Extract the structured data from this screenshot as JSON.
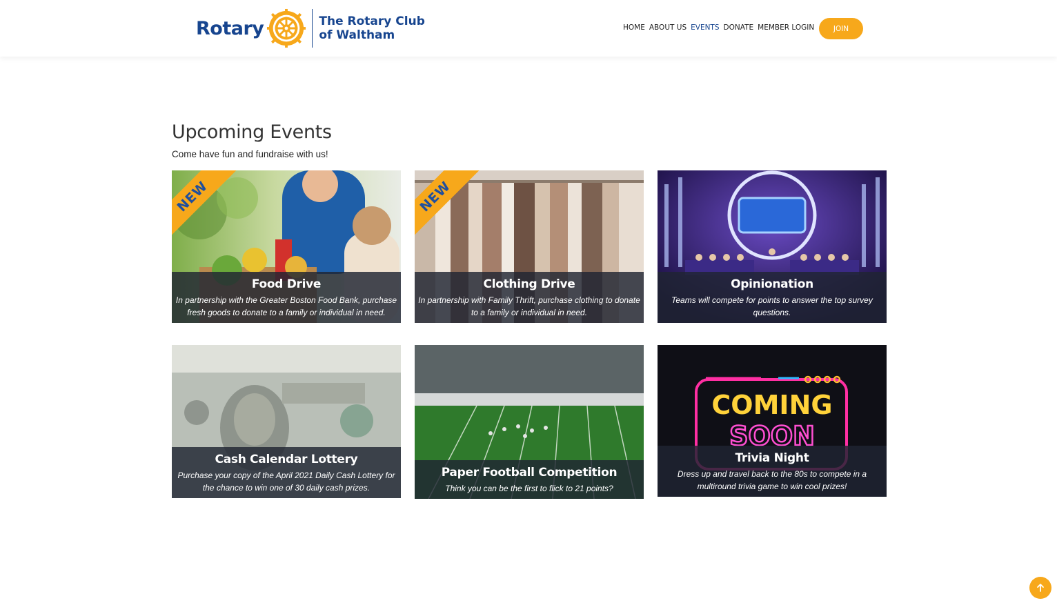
{
  "header": {
    "logo_word": "Rotary",
    "club_line1": "The Rotary Club",
    "club_line2": "of Waltham",
    "nav": [
      "HOME",
      "ABOUT US",
      "EVENTS",
      "DONATE",
      "MEMBER LOGIN"
    ],
    "active_nav": "EVENTS",
    "join_label": "JOIN"
  },
  "section": {
    "title": "Upcoming Events",
    "subtitle": "Come have fun and fundraise with us!"
  },
  "ribbon_label": "NEW",
  "events": [
    {
      "title": "Food Drive",
      "description": "In partnership with the Greater Boston Food Bank, purchase fresh goods to donate to a family or individual in need.",
      "badge": "NEW",
      "image": "food-donation-photo"
    },
    {
      "title": "Clothing Drive",
      "description": "In partnership with Family Thrift, purchase clothing to donate to a family or individual in need.",
      "badge": "NEW",
      "image": "clothing-rack-photo"
    },
    {
      "title": "Opinionation",
      "description": "Teams will compete for points to answer the top survey questions.",
      "badge": "",
      "image": "game-show-stage-photo"
    },
    {
      "title": "Cash Calendar Lottery",
      "description": "Purchase your copy of the April 2021 Daily Cash Lottery for the chance to win one of 30 daily cash prizes.",
      "badge": "",
      "image": "hundred-dollar-bills-photo"
    },
    {
      "title": "Paper Football Competition",
      "description": "Think you can be the first to flick to 21 points?",
      "badge": "",
      "image": "football-stadium-photo"
    },
    {
      "title": "Trivia Night",
      "description": "Dress up and travel back to the 80s to compete in a multiround trivia game to win cool prizes!",
      "badge": "",
      "image": "coming-soon-neon-sign"
    }
  ],
  "trivia_sign": {
    "line1": "COMING",
    "line2": "SOON"
  },
  "colors": {
    "rotary_blue": "#17458f",
    "rotary_gold": "#f7a81b"
  },
  "icons": {
    "scroll_top": "arrow-up-icon",
    "logo": "rotary-wheel-icon"
  }
}
